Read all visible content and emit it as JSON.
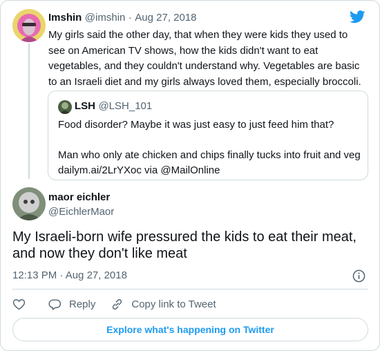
{
  "reply": {
    "name": "Imshin",
    "handle": "@imshin",
    "separator": "·",
    "date": "Aug 27, 2018",
    "text": "My girls said the other day, that when they were kids they used to see on American TV shows, how the kids didn't want to eat vegetables, and they couldn't understand why. Vegetables are basic to an Israeli diet and my girls always loved them, especially broccoli."
  },
  "quote": {
    "name": "LSH",
    "handle": "@LSH_101",
    "line1": "Food disorder? Maybe it was just easy to just feed him that?",
    "line2": "Man who only ate chicken and chips finally tucks into fruit and veg",
    "line3": "dailym.ai/2LrYXoc via @MailOnline"
  },
  "main": {
    "name": "maor eichler",
    "handle": "@EichlerMaor",
    "text": "My Israeli-born wife pressured the kids to eat their meat, and now they don't like meat",
    "time": "12:13 PM · Aug 27, 2018"
  },
  "actions": {
    "reply_label": "Reply",
    "copy_label": "Copy link to Tweet"
  },
  "footer": {
    "explore_label": "Explore what's happening on Twitter"
  },
  "icons": [
    "twitter-bird-icon",
    "info-icon",
    "heart-icon",
    "reply-icon",
    "link-icon"
  ],
  "colors": {
    "accent": "#1d9bf0",
    "text": "#0f1419",
    "muted": "#536471",
    "border": "#cfd9de"
  }
}
